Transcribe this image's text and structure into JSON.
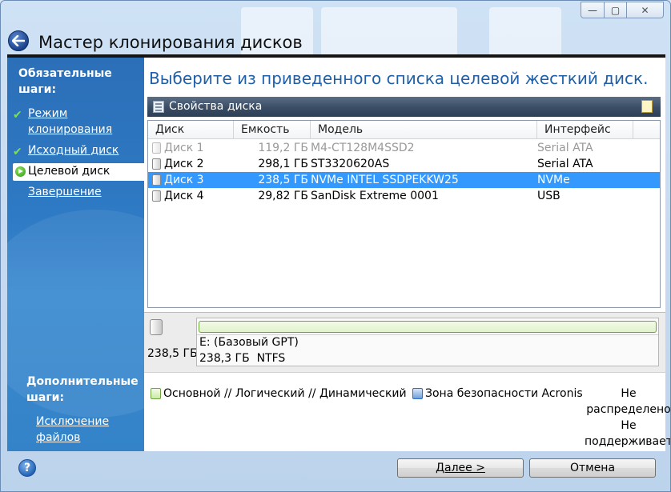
{
  "window": {
    "title": "Мастер клонирования дисков",
    "caption_buttons": {
      "minimize": "—",
      "maximize": "▢",
      "close": "✕"
    }
  },
  "sidebar": {
    "required_heading": "Обязательные шаги:",
    "steps": [
      {
        "label": "Режим клонирования",
        "done": true
      },
      {
        "label": "Исходный диск",
        "done": true
      },
      {
        "label": "Целевой диск",
        "active": true
      },
      {
        "label": "Завершение"
      }
    ],
    "optional_heading": "Дополнительные шаги:",
    "optional_steps": [
      {
        "label": "Исключение файлов"
      }
    ]
  },
  "main": {
    "heading": "Выберите из приведенного списка целевой жесткий диск.",
    "panel_title": "Свойства диска",
    "table": {
      "columns": [
        "Диск",
        "Емкость",
        "Модель",
        "Интерфейс"
      ],
      "rows": [
        {
          "disk": "Диск 1",
          "capacity": "119,2 ГБ",
          "model": "M4-CT128M4SSD2",
          "interface": "Serial ATA",
          "state": "disabled"
        },
        {
          "disk": "Диск 2",
          "capacity": "298,1 ГБ",
          "model": "ST3320620AS",
          "interface": "Serial ATA",
          "state": "normal"
        },
        {
          "disk": "Диск 3",
          "capacity": "238,5 ГБ",
          "model": "NVMe INTEL SSDPEKKW25",
          "interface": "NVMe",
          "state": "selected"
        },
        {
          "disk": "Диск 4",
          "capacity": "29,82 ГБ",
          "model": "SanDisk Extreme 0001",
          "interface": "USB",
          "state": "normal"
        }
      ]
    },
    "disk_map": {
      "disk_size": "238,5 ГБ",
      "partition_label": "E: (Базовый GPT)",
      "partition_size": "238,3 ГБ",
      "partition_fs": "NTFS"
    },
    "legend": {
      "primary": "Основной // Логический // Динамический",
      "acronis": "Зона безопасности Acronis",
      "unallocated_line1": "Не",
      "unallocated_line2": "распределено",
      "unsupported_line1": "Не",
      "unsupported_line2": "поддерживается",
      "colors": {
        "primary": "#8cc63f",
        "acronis": "#2f6fc0"
      }
    }
  },
  "footer": {
    "help": "?",
    "next": "Далее >",
    "cancel": "Отмена"
  },
  "colors": {
    "sidebar": "#2e7ac4",
    "heading": "#1f5fa8",
    "selection": "#3399ff"
  }
}
